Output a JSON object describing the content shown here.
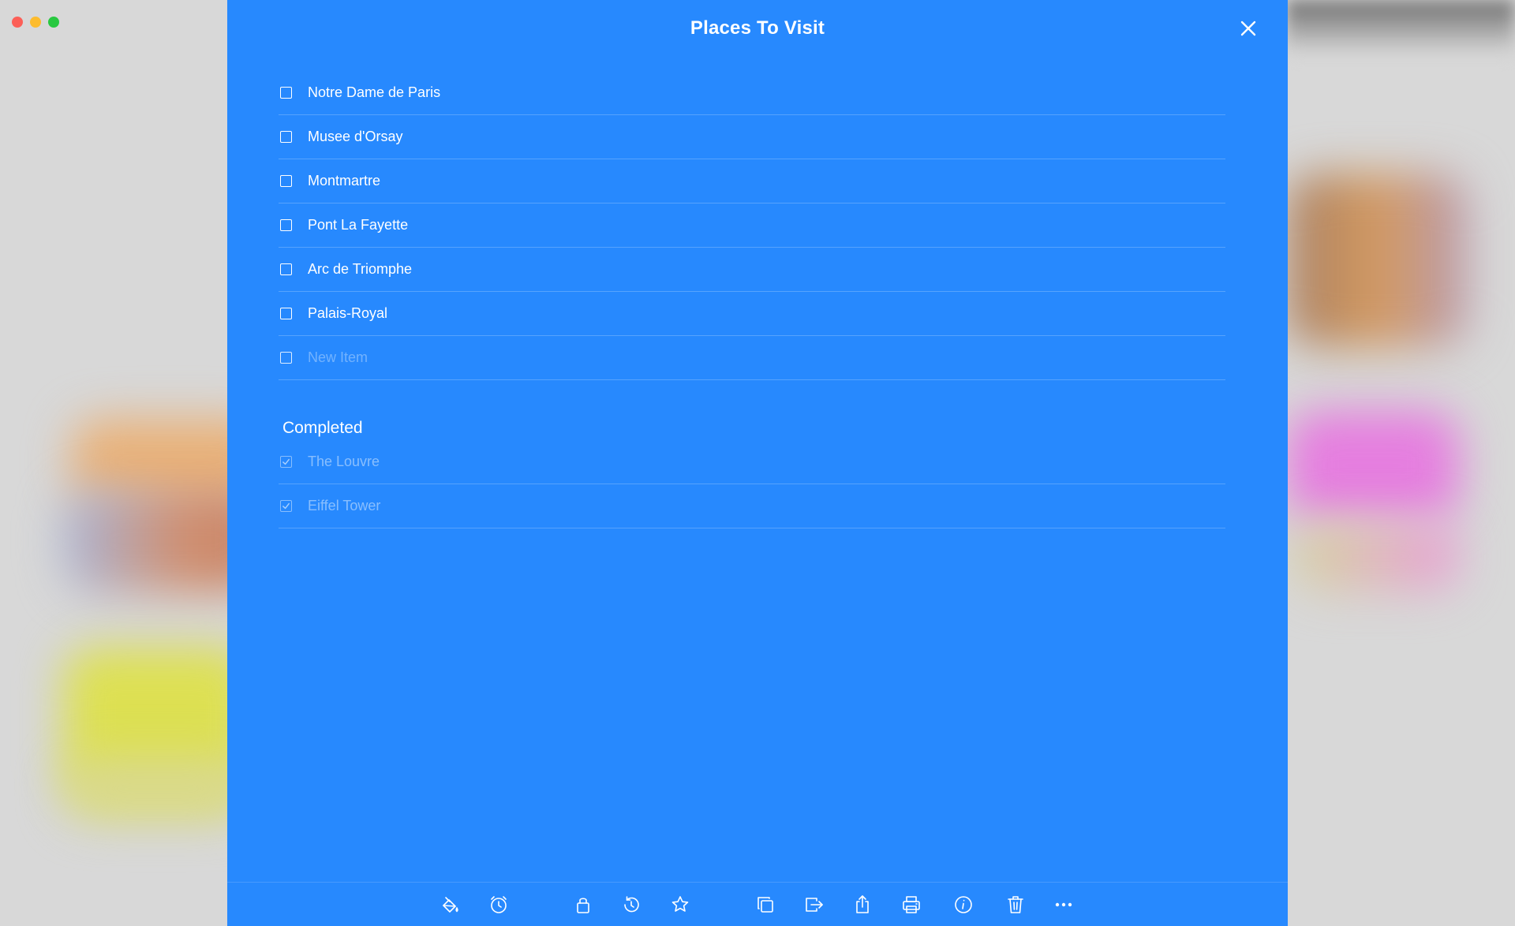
{
  "window": {
    "traffic_lights": [
      "close",
      "minimize",
      "maximize"
    ]
  },
  "note": {
    "title": "Places To Visit",
    "background_color": "#2789fe",
    "close_icon": "close-icon",
    "items": [
      {
        "label": "Notre Dame de Paris",
        "checked": false
      },
      {
        "label": "Musee d'Orsay",
        "checked": false
      },
      {
        "label": "Montmartre",
        "checked": false
      },
      {
        "label": "Pont La Fayette",
        "checked": false
      },
      {
        "label": "Arc de Triomphe",
        "checked": false
      },
      {
        "label": "Palais-Royal",
        "checked": false
      }
    ],
    "new_item_placeholder": "New Item",
    "completed": {
      "heading": "Completed",
      "items": [
        {
          "label": "The Louvre",
          "checked": true
        },
        {
          "label": "Eiffel Tower",
          "checked": true
        }
      ]
    }
  },
  "toolbar": {
    "icons": [
      "paint-bucket-icon",
      "alarm-clock-icon",
      "lock-icon",
      "history-icon",
      "star-icon",
      "duplicate-icon",
      "export-icon",
      "share-icon",
      "print-icon",
      "info-icon",
      "trash-icon",
      "more-icon"
    ]
  }
}
